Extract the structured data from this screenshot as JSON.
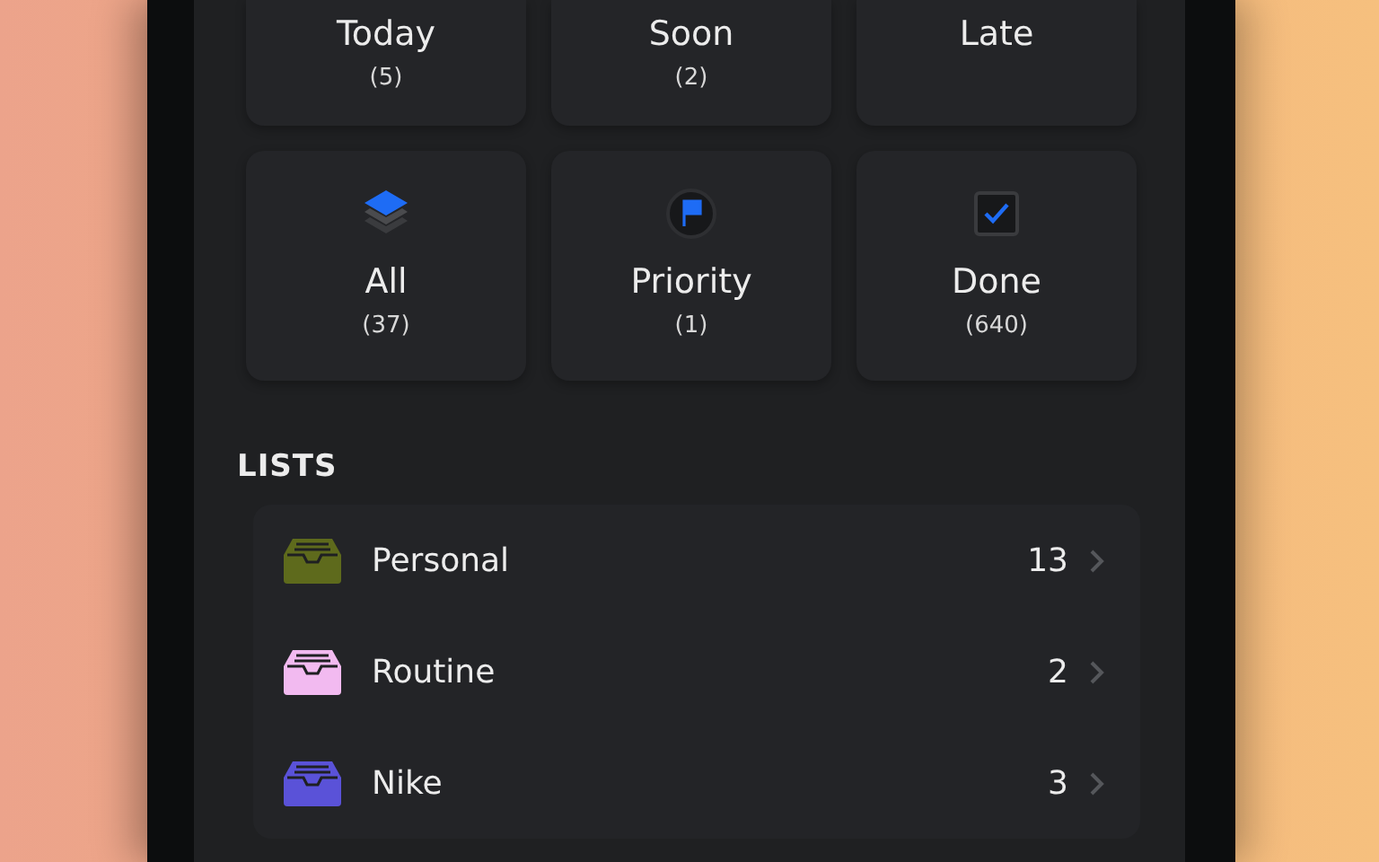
{
  "smart_lists": [
    {
      "label": "Today",
      "count": "(5)",
      "kind": "date"
    },
    {
      "label": "Soon",
      "count": "(2)",
      "kind": "date"
    },
    {
      "label": "Late",
      "kind": "date"
    },
    {
      "label": "All",
      "count": "(37)",
      "kind": "all"
    },
    {
      "label": "Priority",
      "count": "(1)",
      "kind": "priority"
    },
    {
      "label": "Done",
      "count": "(640)",
      "kind": "done"
    }
  ],
  "lists_heading": "LISTS",
  "lists": [
    {
      "name": "Personal",
      "count": "13",
      "color": "#5e6a1c"
    },
    {
      "name": "Routine",
      "count": "2",
      "color": "#f2baf0"
    },
    {
      "name": "Nike",
      "count": "3",
      "color": "#5a52d8"
    }
  ]
}
